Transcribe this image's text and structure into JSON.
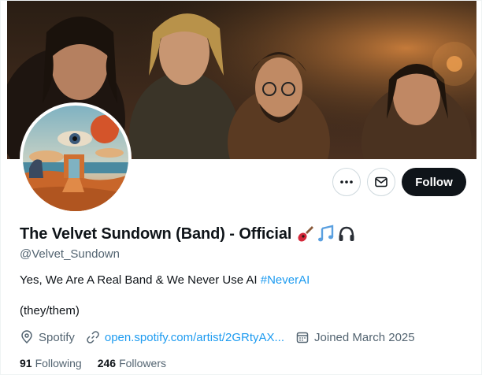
{
  "profile": {
    "display_name": "The Velvet Sundown (Band) - Official",
    "name_emojis": [
      "guitar-icon",
      "music-notes-icon",
      "headphones-icon"
    ],
    "handle": "@Velvet_Sundown",
    "bio_text": "Yes, We Are A Real Band & We Never Use AI ",
    "bio_hashtag": "#NeverAI",
    "pronouns": "(they/them)",
    "location": "Spotify",
    "website": "open.spotify.com/artist/2GRtyAX...",
    "joined": "Joined March 2025",
    "following_count": "91",
    "following_label": "Following",
    "followers_count": "246",
    "followers_label": "Followers"
  },
  "actions": {
    "follow_label": "Follow",
    "more_icon": "more-dots-icon",
    "message_icon": "envelope-icon"
  },
  "colors": {
    "accent": "#1d9bf0",
    "follow_bg": "#0f1419",
    "muted_text": "#536471"
  }
}
